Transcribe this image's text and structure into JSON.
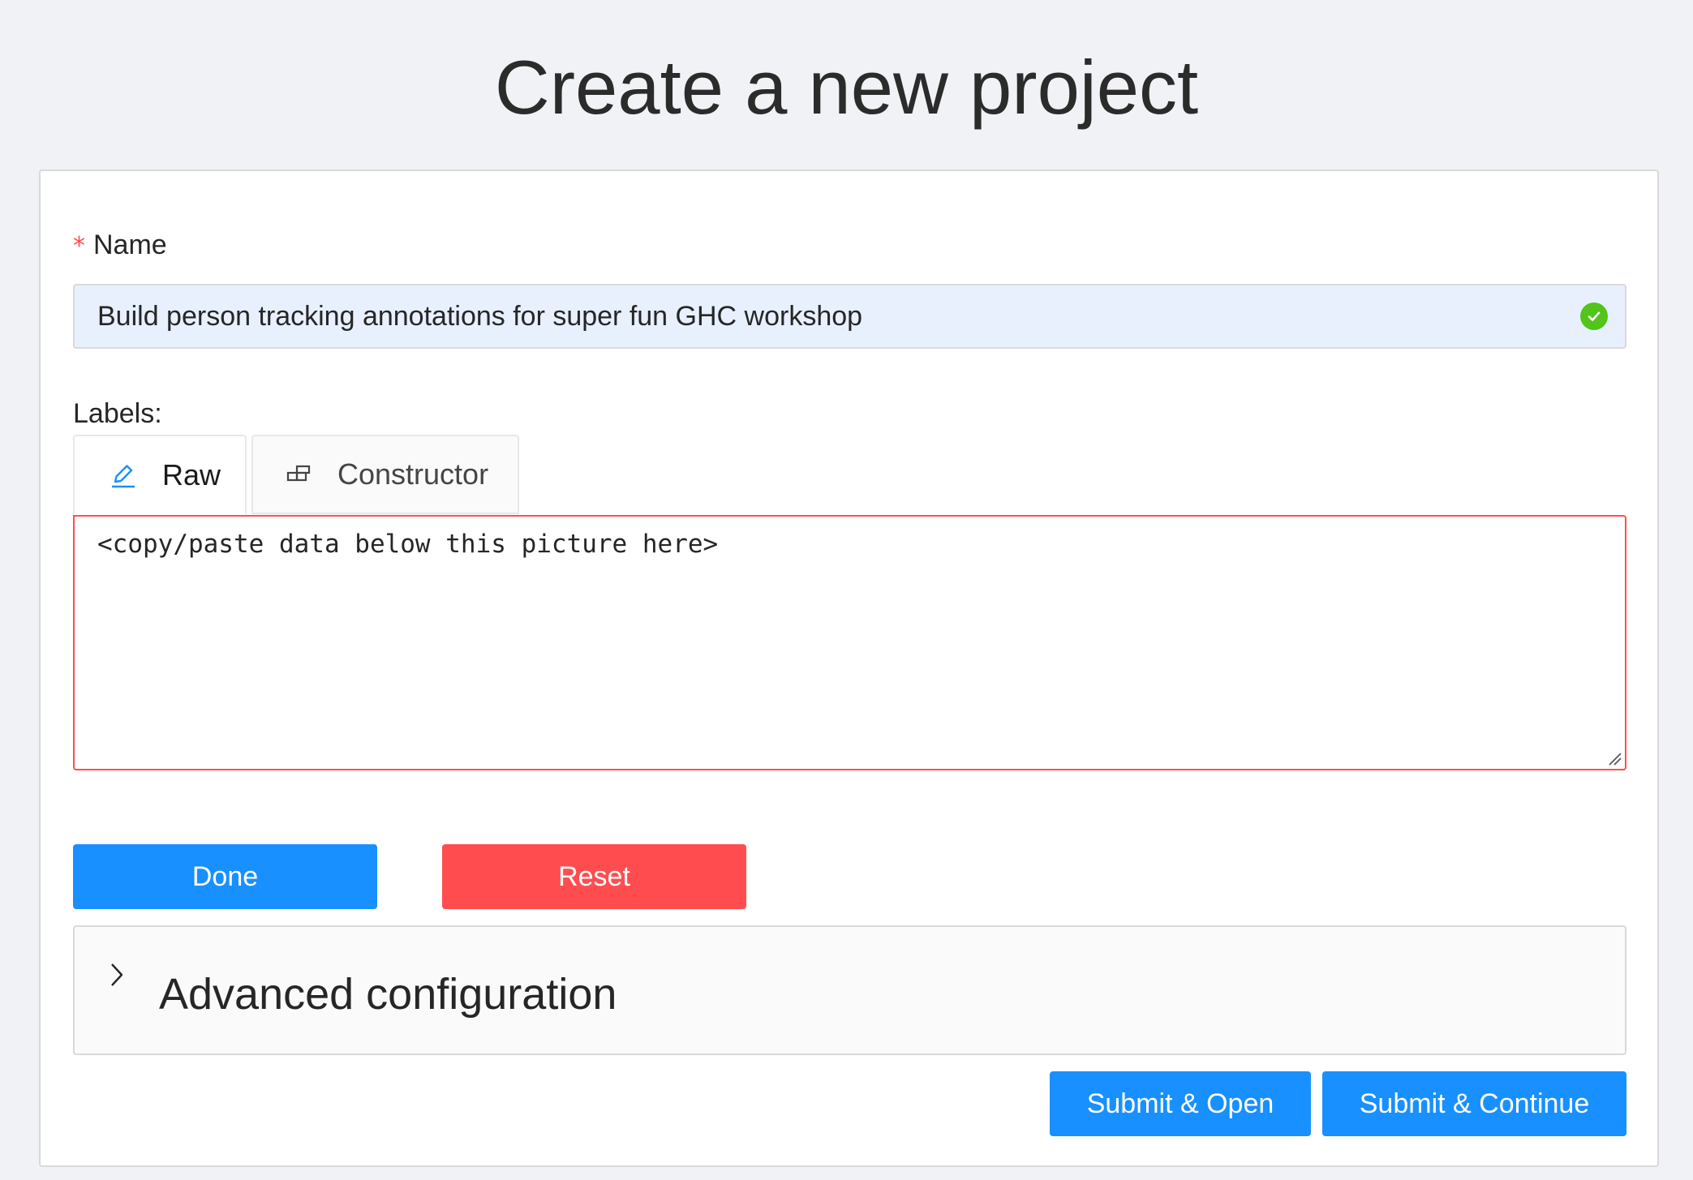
{
  "page": {
    "title": "Create a new project"
  },
  "form": {
    "name": {
      "required_mark": "*",
      "label": "Name",
      "value": "Build person tracking annotations for super fun GHC workshop",
      "status_icon": "check-circle-icon",
      "status_color": "#52c41a"
    },
    "labels": {
      "label": "Labels:",
      "tabs": [
        {
          "label": "Raw",
          "icon": "edit-icon",
          "active": true
        },
        {
          "label": "Constructor",
          "icon": "build-icon",
          "active": false
        }
      ],
      "raw_value": "<copy/paste data below this picture here>",
      "error_color": "#ff4d4f"
    },
    "actions": {
      "done_label": "Done",
      "reset_label": "Reset"
    },
    "advanced": {
      "title": "Advanced configuration",
      "expanded": false,
      "icon": "chevron-right-icon"
    },
    "submit": {
      "open_label": "Submit & Open",
      "continue_label": "Submit & Continue"
    }
  },
  "colors": {
    "primary": "#1890ff",
    "danger": "#ff4d4f",
    "success": "#52c41a",
    "background": "#f0f2f5",
    "autofill": "#e8f0fe"
  }
}
